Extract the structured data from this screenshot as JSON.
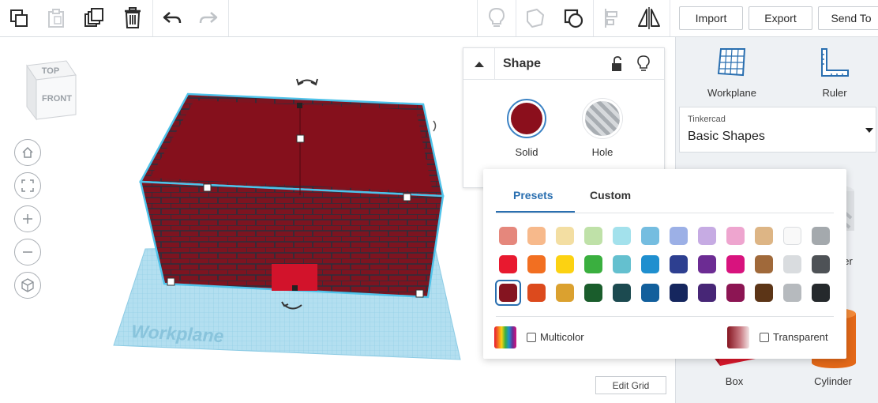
{
  "toolbar": {
    "import_label": "Import",
    "export_label": "Export",
    "send_to_label": "Send To",
    "icons": [
      "copy-icon",
      "paste-icon",
      "duplicate-icon",
      "delete-icon",
      "undo-icon",
      "redo-icon",
      "notes-icon",
      "comment-icon",
      "show-all-icon",
      "align-icon",
      "mirror-icon"
    ]
  },
  "viewcube": {
    "top": "TOP",
    "front": "FRONT"
  },
  "workplane_label": "Workplane",
  "edit_grid_label": "Edit Grid",
  "inspector": {
    "title": "Shape",
    "solid_label": "Solid",
    "hole_label": "Hole",
    "solid_color": "#8b0f1c"
  },
  "picker": {
    "tab_presets": "Presets",
    "tab_custom": "Custom",
    "active_tab": "Presets",
    "multicolor_label": "Multicolor",
    "transparent_label": "Transparent",
    "selected_color": "#851420",
    "colors": [
      [
        "#e5877c",
        "#f7b98b",
        "#f3dea2",
        "#bfe1a8",
        "#a3e1ec",
        "#75bde0",
        "#9cb0e6",
        "#c6abe3",
        "#eea5cf",
        "#ddb585",
        "#f9f9f9",
        "#a4a9ad"
      ],
      [
        "#e8192f",
        "#f26f21",
        "#fcd212",
        "#3aaf3f",
        "#64c0cf",
        "#1f8fcf",
        "#2d3f90",
        "#6c2c93",
        "#d8137e",
        "#a0693a",
        "#d9dcdf",
        "#4e5256"
      ],
      [
        "#851420",
        "#dc4a1d",
        "#dba12f",
        "#1a5d2c",
        "#1c4a50",
        "#125f9c",
        "#15265e",
        "#472676",
        "#8c1553",
        "#5c3517",
        "#b6babe",
        "#25292c"
      ]
    ]
  },
  "right_panel": {
    "workplane_label": "Workplane",
    "ruler_label": "Ruler",
    "library_group": "Tinkercad",
    "library_name": "Basic Shapes",
    "shapes": [
      "Box",
      "Cylinder"
    ],
    "partial_label": "er"
  }
}
